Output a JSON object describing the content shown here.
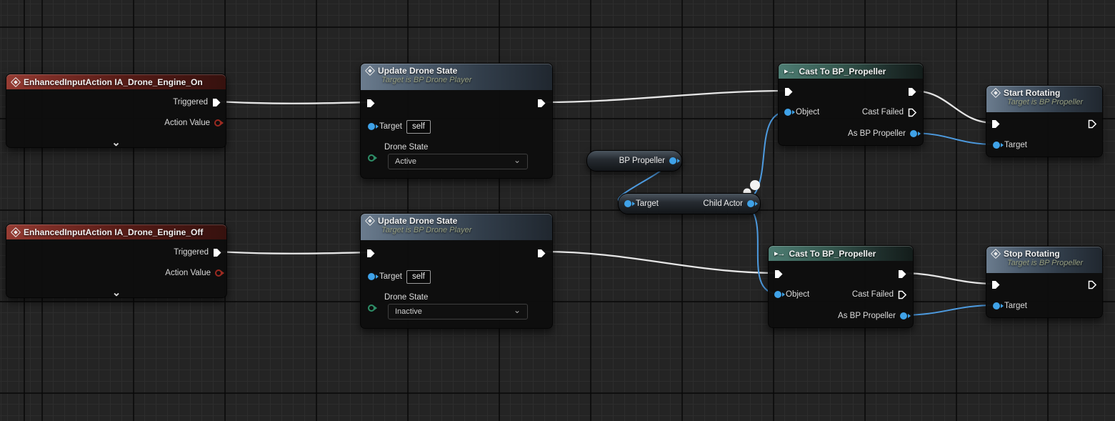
{
  "colors": {
    "exec_wire": "#e6e6e6",
    "data_wire": "#4d9be0",
    "pin_blue": "#3fa2e8",
    "value_pin_red": "#9c2a21",
    "enum_pin_green": "#2e8f68",
    "event_header": "#7c2d26",
    "function_header": "#4d5d6e",
    "cast_header": "#35584f"
  },
  "icons": {
    "cast_glyph": "▸→",
    "collapse_chevron": "⌄",
    "dropdown_chevron": "⌄"
  },
  "nodes": {
    "event_on": {
      "title": "EnhancedInputAction IA_Drone_Engine_On",
      "triggered": "Triggered",
      "action_value": "Action Value"
    },
    "event_off": {
      "title": "EnhancedInputAction IA_Drone_Engine_Off",
      "triggered": "Triggered",
      "action_value": "Action Value"
    },
    "update_active": {
      "title": "Update Drone State",
      "subtitle": "Target is BP Drone Player",
      "target": "Target",
      "target_value": "self",
      "state_label": "Drone State",
      "state_value": "Active"
    },
    "update_inactive": {
      "title": "Update Drone State",
      "subtitle": "Target is BP Drone Player",
      "target": "Target",
      "target_value": "self",
      "state_label": "Drone State",
      "state_value": "Inactive"
    },
    "bp_propeller": {
      "label": "BP Propeller"
    },
    "child_actor": {
      "target": "Target",
      "child": "Child Actor"
    },
    "cast_on": {
      "title": "Cast To BP_Propeller",
      "object": "Object",
      "cast_failed": "Cast Failed",
      "as_propeller": "As BP Propeller"
    },
    "cast_off": {
      "title": "Cast To BP_Propeller",
      "object": "Object",
      "cast_failed": "Cast Failed",
      "as_propeller": "As BP Propeller"
    },
    "start_rotating": {
      "title": "Start Rotating",
      "subtitle": "Target is BP Propeller",
      "target": "Target"
    },
    "stop_rotating": {
      "title": "Stop Rotating",
      "subtitle": "Target is BP Propeller",
      "target": "Target"
    }
  }
}
